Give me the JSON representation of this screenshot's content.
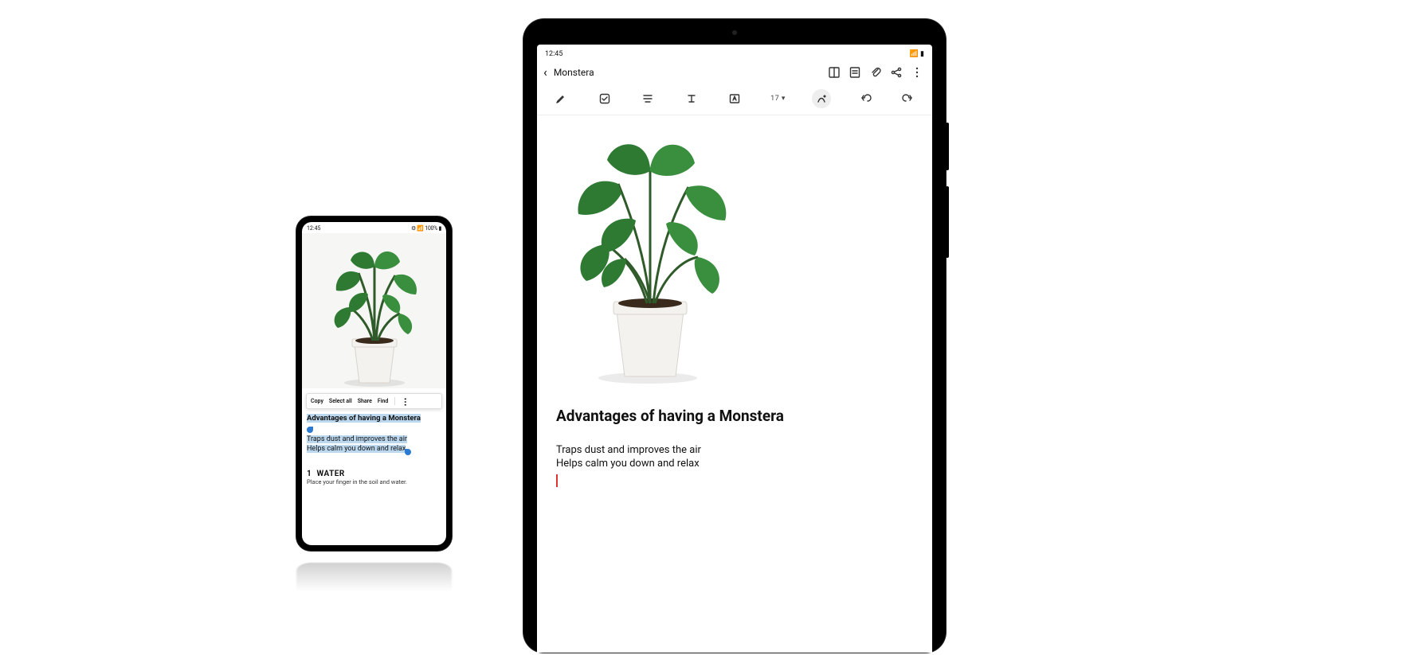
{
  "phone": {
    "status": {
      "time": "12:45",
      "right": "⚙ 📶 100% ▮"
    },
    "context_menu": {
      "copy": "Copy",
      "select_all": "Select all",
      "share": "Share",
      "find": "Find"
    },
    "heading": "Advantages of having a Monstera",
    "line1": "Traps dust and improves the air",
    "line2": "Helps calm you down and relax",
    "section": {
      "num": "1",
      "title": "WATER",
      "body": "Place your finger in the soil and water."
    }
  },
  "tablet": {
    "status": {
      "time": "12:45",
      "right": "📶 ▮"
    },
    "header": {
      "title": "Monstera"
    },
    "toolbar": {
      "font_size": "17 ▾"
    },
    "heading": "Advantages of having a Monstera",
    "line1": "Traps dust and improves the air",
    "line2": "Helps calm you down and relax"
  }
}
